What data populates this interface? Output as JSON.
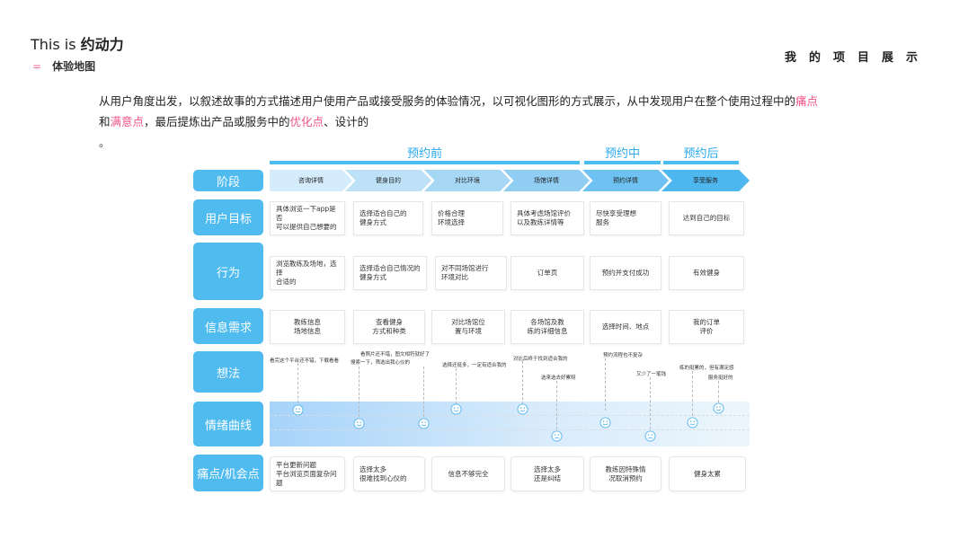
{
  "header": {
    "title_prefix": "This is ",
    "title_name": "约动力",
    "subtitle_dash": "=",
    "subtitle": "体验地图",
    "section_label": "我的项目展示"
  },
  "intro": {
    "part1": "从用户角度出发，以叙述故事的方式描述用户使用产品或接受服务的体验情况，以可视化图形的方式展示，从中发现用户在整个使用过程中的",
    "hl1": "痛点",
    "part2": "和",
    "hl2": "满意点",
    "part3": "，最后提炼出产品或服务中的",
    "hl3": "优化点",
    "part4": "、设计的",
    "dot": "。"
  },
  "phases": [
    "预约前",
    "预约中",
    "预约后"
  ],
  "row_labels": {
    "stage": "阶段",
    "goal": "用户目标",
    "behavior": "行为",
    "info": "信息需求",
    "thought": "想法",
    "emotion": "情绪曲线",
    "pain": "痛点/机会点"
  },
  "stages": [
    "咨询详情",
    "健身目的",
    "对比环境",
    "场馆详情",
    "预约详情",
    "享受服务"
  ],
  "goals": [
    "具体浏览一下app是否\n可以提供自己想要的",
    "选择适合自己的\n健身方式",
    "价格合理\n环境选择",
    "具体考虑场馆评价\n以及教练详情等",
    "尽快享受理想\n服务",
    "达到自己的目标"
  ],
  "behaviors": [
    "浏览教练及场地，选择\n合适的",
    "选择适合自己情况的\n健身方式",
    "对不同场馆进行\n环境对比",
    "订单页",
    "预约并支付成功",
    "有效健身"
  ],
  "info_needs": [
    "教练信息\n场地信息",
    "查看健身\n方式和种类",
    "对比场馆位\n置与环境",
    "各场馆及教\n练的详细信息",
    "选择时间、地点",
    "我的订单\n评价"
  ],
  "thoughts": [
    "看完这个平台还不错，下载看看",
    "看照片还不错，图文相符就好了",
    "搜索一下，筛选出我心仪的",
    "选择还挺多，一定有适合我的",
    "对比后终于找到适合我的",
    "选来选去好累呀",
    "预约流程也不复杂",
    "又少了一笔钱",
    "练的挺累的，但有满足感",
    "服务挺好的"
  ],
  "emotions": [
    "smile",
    "smile",
    "smile",
    "smile",
    "smile",
    "sad",
    "smile",
    "sad",
    "smile",
    "smile"
  ],
  "pains": [
    "平台更新问题\n平台浏览页面复杂问题",
    "选择太多\n很难找到心仪的",
    "信息不够完全",
    "选择太多\n还是纠结",
    "教练因特殊情\n况取消预约",
    "健身太累"
  ],
  "colors": {
    "accent": "#4fbbee",
    "highlight": "#f0508a",
    "stage_arrows": [
      "#d4ecfb",
      "#bde2f8",
      "#a6d8f6",
      "#8fcdf3",
      "#6dc2f1",
      "#4fb7ef"
    ]
  }
}
